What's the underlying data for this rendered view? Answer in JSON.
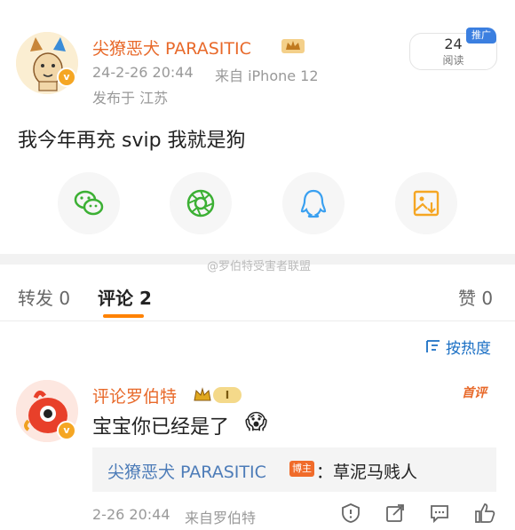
{
  "post": {
    "author": "尖獠恶犬 PARASITIC",
    "timestamp": "24-2-26 20:44",
    "source": "来自 iPhone 12",
    "location": "发布于 江苏",
    "text": "我今年再充 svip 我就是狗",
    "reads": "24",
    "reads_label": "阅读",
    "promo_badge": "推广"
  },
  "share": {
    "items": [
      {
        "name": "wechat-icon",
        "color": "#3cb034"
      },
      {
        "name": "moments-icon",
        "color": "#3cb034"
      },
      {
        "name": "qq-icon",
        "color": "#3aa0f0"
      },
      {
        "name": "save-image-icon",
        "color": "#f5a623"
      }
    ]
  },
  "watermark": "@罗伯特受害者联盟",
  "tabs": {
    "repost": "转发 0",
    "comments": "评论 2",
    "likes": "赞 0",
    "sort": "按热度"
  },
  "comment": {
    "author": "评论罗伯特",
    "vip_level": "I",
    "text": "宝宝你已经是了",
    "emoji": "😱",
    "tag": "首评",
    "reply_author": "尖獠恶犬 PARASITIC",
    "reply_badge": "博主",
    "reply_text": "：草泥马贱人",
    "time": "2-26 20:44",
    "source": "来自罗伯特"
  },
  "colors": {
    "accent": "#ff8200",
    "username": "#e8692a",
    "meta": "#999999"
  }
}
